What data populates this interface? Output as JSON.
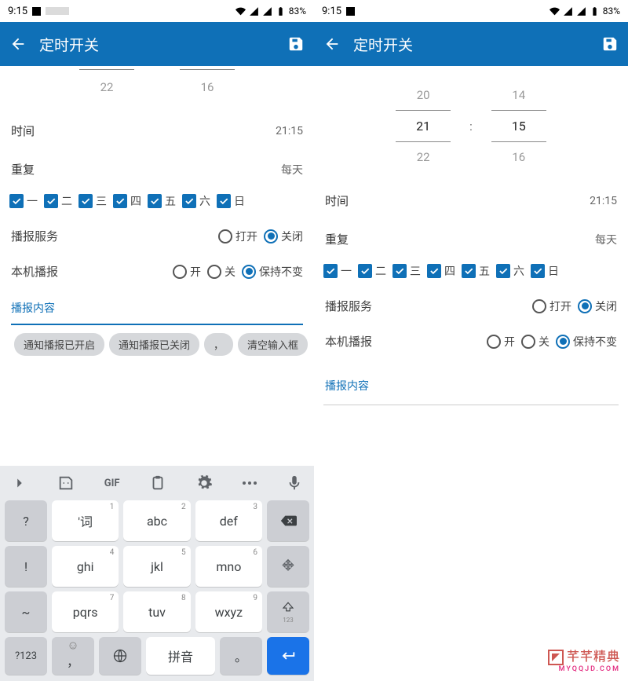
{
  "status": {
    "time": "9:15",
    "battery": "83%"
  },
  "appbar": {
    "title": "定时开关"
  },
  "picker": {
    "ghost_prev_h": "20",
    "ghost_prev_m": "14",
    "sel_h": "21",
    "sel_m": "15",
    "colon": ":",
    "ghost_next_h": "22",
    "ghost_next_m": "16"
  },
  "rows": {
    "time_label": "时间",
    "time_value": "21:15",
    "repeat_label": "重复",
    "repeat_value": "每天"
  },
  "days": {
    "d0": "一",
    "d1": "二",
    "d2": "三",
    "d3": "四",
    "d4": "五",
    "d5": "六",
    "d6": "日"
  },
  "broadcast_service": {
    "label": "播报服务",
    "opt_open": "打开",
    "opt_close": "关闭"
  },
  "local_broadcast": {
    "label": "本机播报",
    "opt_on": "开",
    "opt_off": "关",
    "opt_keep": "保持不变"
  },
  "content_label": "播报内容",
  "chips": {
    "c0": "通知播报已开启",
    "c1": "通知播报已关闭",
    "c2": "，",
    "c3": "清空输入框"
  },
  "kbd": {
    "gif": "GIF",
    "k_q": "?",
    "k_tilde": "~",
    "k_numsym": "?123",
    "w1": "'词",
    "w2": "abc",
    "w3": "def",
    "w4": "ghi",
    "w5": "jkl",
    "w6": "mno",
    "w7": "pqrs",
    "w8": "tuv",
    "w9": "wxyz",
    "sup1": "1",
    "sup2": "2",
    "sup3": "3",
    "sup4": "4",
    "sup5": "5",
    "sup6": "6",
    "sup7": "7",
    "sup8": "8",
    "sup9": "9",
    "shift_sub": "123",
    "space": "拼音",
    "comma": "，"
  },
  "watermark": {
    "brand": "芊芊精典",
    "url": "MYQQJD.COM"
  }
}
